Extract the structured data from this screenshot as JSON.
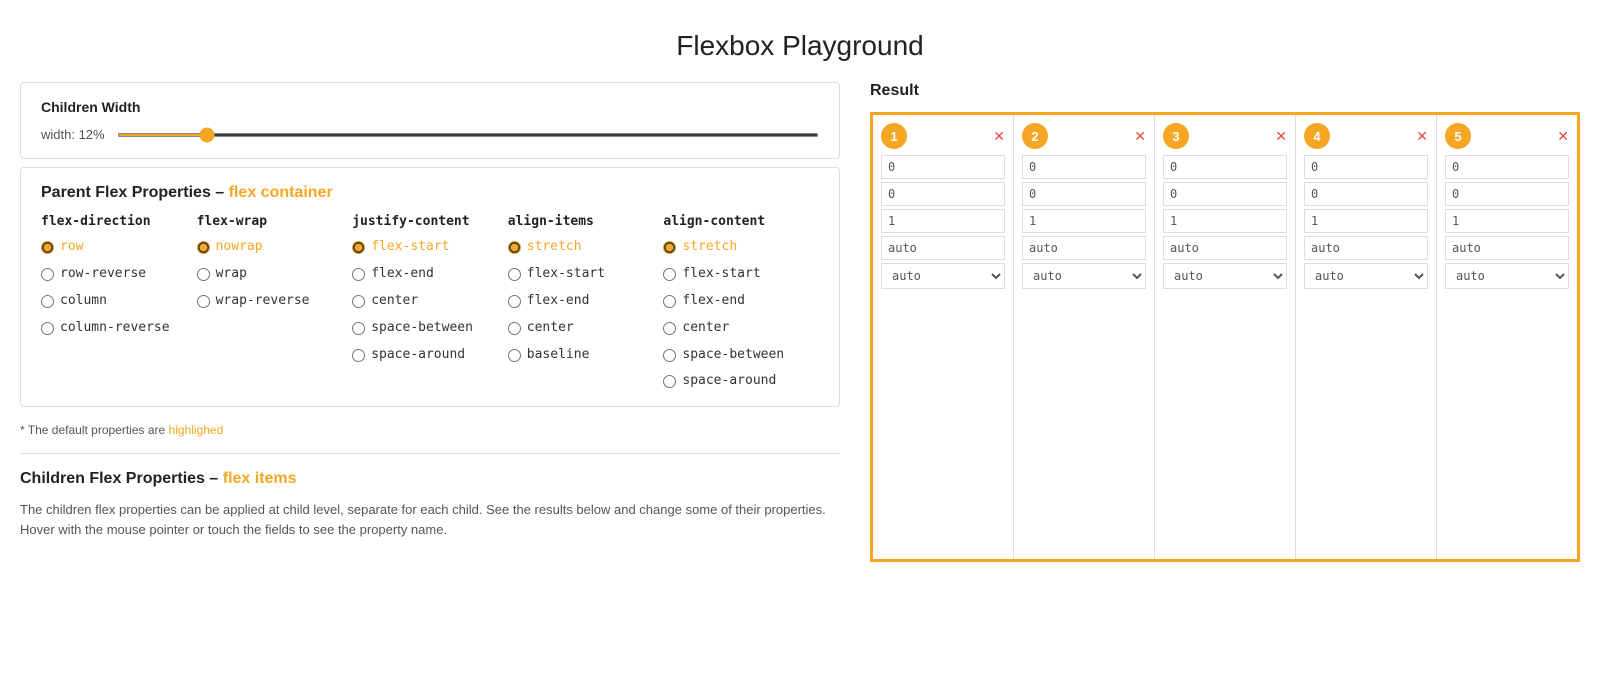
{
  "page": {
    "title": "Flexbox Playground"
  },
  "children_width": {
    "section_title": "Children Width",
    "slider_label": "width: 12%",
    "slider_value": 12,
    "slider_min": 0,
    "slider_max": 100
  },
  "parent_flex": {
    "section_title": "Parent Flex Properties – ",
    "section_highlight": "flex container",
    "flex_direction": {
      "title": "flex-direction",
      "options": [
        "row",
        "row-reverse",
        "column",
        "column-reverse"
      ],
      "selected": "row"
    },
    "flex_wrap": {
      "title": "flex-wrap",
      "options": [
        "nowrap",
        "wrap",
        "wrap-reverse"
      ],
      "selected": "nowrap"
    },
    "justify_content": {
      "title": "justify-content",
      "options": [
        "flex-start",
        "flex-end",
        "center",
        "space-between",
        "space-around"
      ],
      "selected": "flex-start"
    },
    "align_items": {
      "title": "align-items",
      "options": [
        "stretch",
        "flex-start",
        "flex-end",
        "center",
        "baseline"
      ],
      "selected": "stretch"
    },
    "align_content": {
      "title": "align-content",
      "options": [
        "stretch",
        "flex-start",
        "flex-end",
        "center",
        "space-between",
        "space-around"
      ],
      "selected": "stretch"
    }
  },
  "note": {
    "text": "* The default properties are ",
    "highlight": "highlighed"
  },
  "children_flex": {
    "section_title": "Children Flex Properties – ",
    "section_highlight": "flex items",
    "description": "The children flex properties can be applied at child level, separate for each child. See the results below and change some of their properties. Hover with the mouse pointer or touch the fields to see the property name."
  },
  "result": {
    "title": "Result",
    "cards": [
      {
        "number": "1",
        "field1": "0",
        "field2": "0",
        "field3": "1",
        "field4": "auto",
        "select": "auto"
      },
      {
        "number": "2",
        "field1": "0",
        "field2": "0",
        "field3": "1",
        "field4": "auto",
        "select": "auto"
      },
      {
        "number": "3",
        "field1": "0",
        "field2": "0",
        "field3": "1",
        "field4": "auto",
        "select": "auto"
      },
      {
        "number": "4",
        "field1": "0",
        "field2": "0",
        "field3": "1",
        "field4": "auto",
        "select": "auto"
      },
      {
        "number": "5",
        "field1": "0",
        "field2": "0",
        "field3": "1",
        "field4": "auto",
        "select": "auto"
      }
    ]
  }
}
